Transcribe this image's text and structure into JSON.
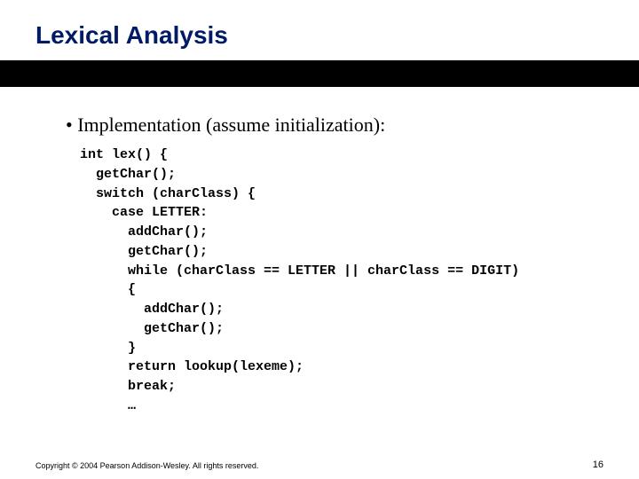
{
  "title": "Lexical Analysis",
  "bullet": "Implementation (assume initialization):",
  "code": "int lex() {\n  getChar();\n  switch (charClass) {\n    case LETTER:\n      addChar();\n      getChar();\n      while (charClass == LETTER || charClass == DIGIT)\n      {\n        addChar();\n        getChar();\n      }\n      return lookup(lexeme);\n      break;\n      …",
  "footer": {
    "copyright": "Copyright © 2004 Pearson Addison-Wesley. All rights reserved.",
    "page": "16"
  }
}
